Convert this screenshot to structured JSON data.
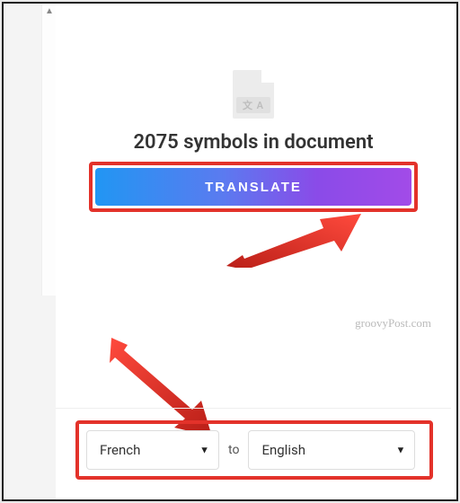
{
  "icon": {
    "tag_text": "文 A"
  },
  "symbols_line": "2075 symbols in document",
  "translate_label": "TRANSLATE",
  "watermark": "groovyPost.com",
  "lang": {
    "from": "French",
    "to_label": "to",
    "to": "English"
  },
  "colors": {
    "highlight": "#e3322a",
    "grad_start": "#2196f3",
    "grad_end": "#a24be8"
  }
}
